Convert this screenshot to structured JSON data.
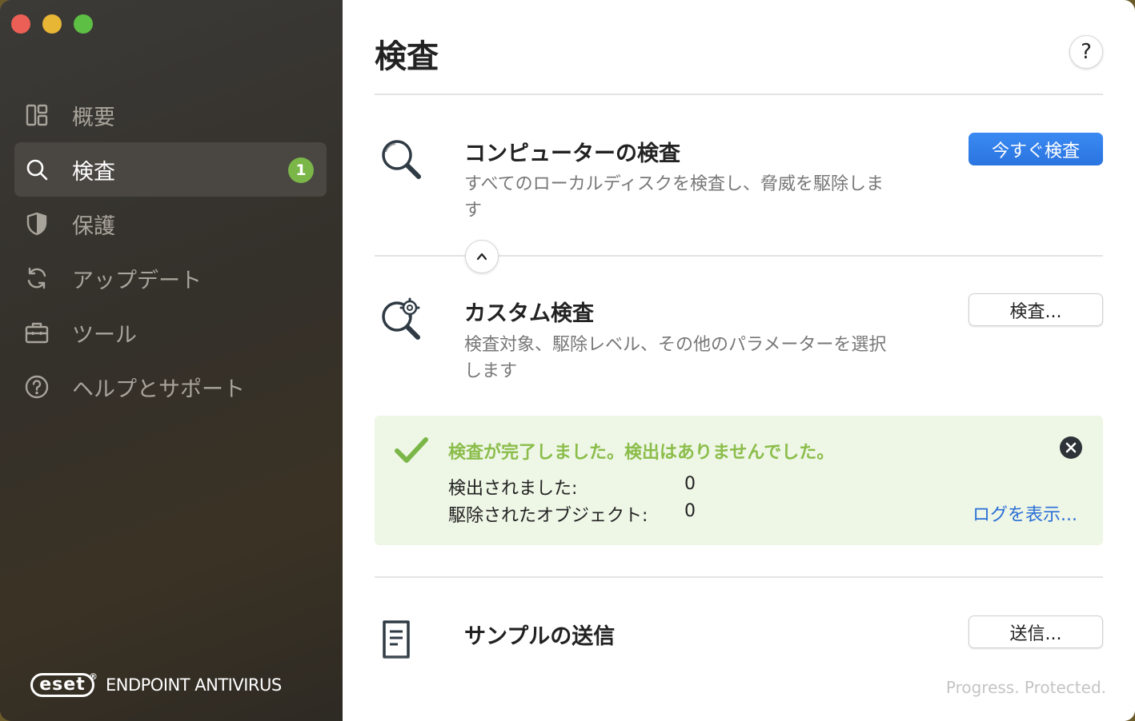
{
  "sidebar": {
    "items": [
      {
        "label": "概要",
        "icon": "dashboard-icon"
      },
      {
        "label": "検査",
        "icon": "search-icon",
        "badge": "1"
      },
      {
        "label": "保護",
        "icon": "shield-icon"
      },
      {
        "label": "アップデート",
        "icon": "refresh-icon"
      },
      {
        "label": "ツール",
        "icon": "briefcase-icon"
      },
      {
        "label": "ヘルプとサポート",
        "icon": "help-circle-icon"
      }
    ],
    "brand": {
      "logo": "eset",
      "reg": "®",
      "product": "ENDPOINT ANTIVIRUS"
    }
  },
  "main": {
    "title": "検査",
    "help_label": "?",
    "computer_scan": {
      "title": "コンピューターの検査",
      "description": "すべてのローカルディスクを検査し、脅威を駆除します",
      "button": "今すぐ検査"
    },
    "custom_scan": {
      "title": "カスタム検査",
      "description": "検査対象、駆除レベル、その他のパラメーターを選択します",
      "button": "検査..."
    },
    "result": {
      "title": "検査が完了しました。検出はありませんでした。",
      "detected_label": "検出されました:",
      "detected_value": "0",
      "cleaned_label": "駆除されたオブジェクト:",
      "cleaned_value": "0",
      "log_link": "ログを表示..."
    },
    "sample": {
      "title": "サンプルの送信",
      "button": "送信..."
    },
    "tagline": "Progress. Protected."
  },
  "colors": {
    "accent": "#2f80ed",
    "badge": "#7ab648",
    "success": "#8bbd4a",
    "success_bg": "#eef6e6",
    "link": "#2a6fd6"
  }
}
